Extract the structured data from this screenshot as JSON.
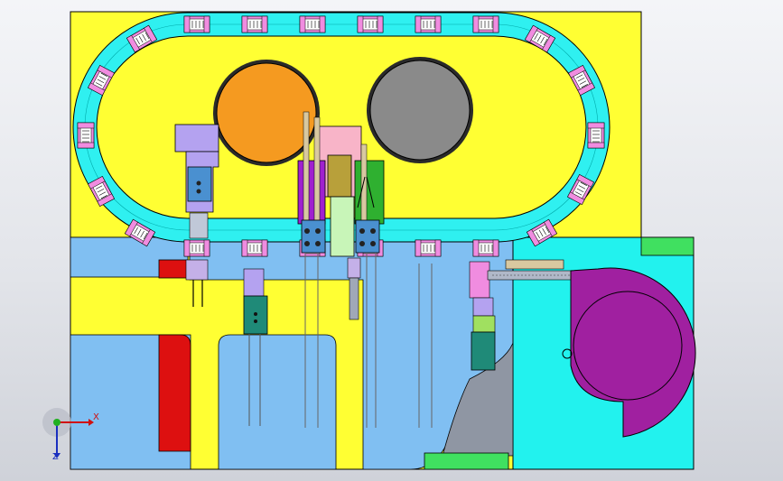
{
  "viewport": {
    "title": "",
    "background": "#e6e8ec"
  },
  "colors": {
    "plate_yellow": "#ffff33",
    "plate_blue": "#80bff2",
    "plate_cyan": "#22f2ee",
    "track_cyan": "#2ff0f0",
    "carrier_pink": "#f08ce0",
    "drum_orange": "#f59a20",
    "drum_gray": "#8a8a8a",
    "lavender": "#b4a2f0",
    "purple_block": "#a020d0",
    "olive_block": "#b8a03a",
    "green_block": "#2fb030",
    "pink_panel": "#f8b4c8",
    "red_block": "#dd1010",
    "green_pad": "#40e060",
    "magenta_disk": "#a020a0",
    "teal_cylinder": "#1f8a78",
    "edge": "#000000"
  },
  "icons": {
    "orientation_triad": "xyz-triad-icon"
  },
  "triad": {
    "x_label": "X",
    "z_label": "Z"
  }
}
